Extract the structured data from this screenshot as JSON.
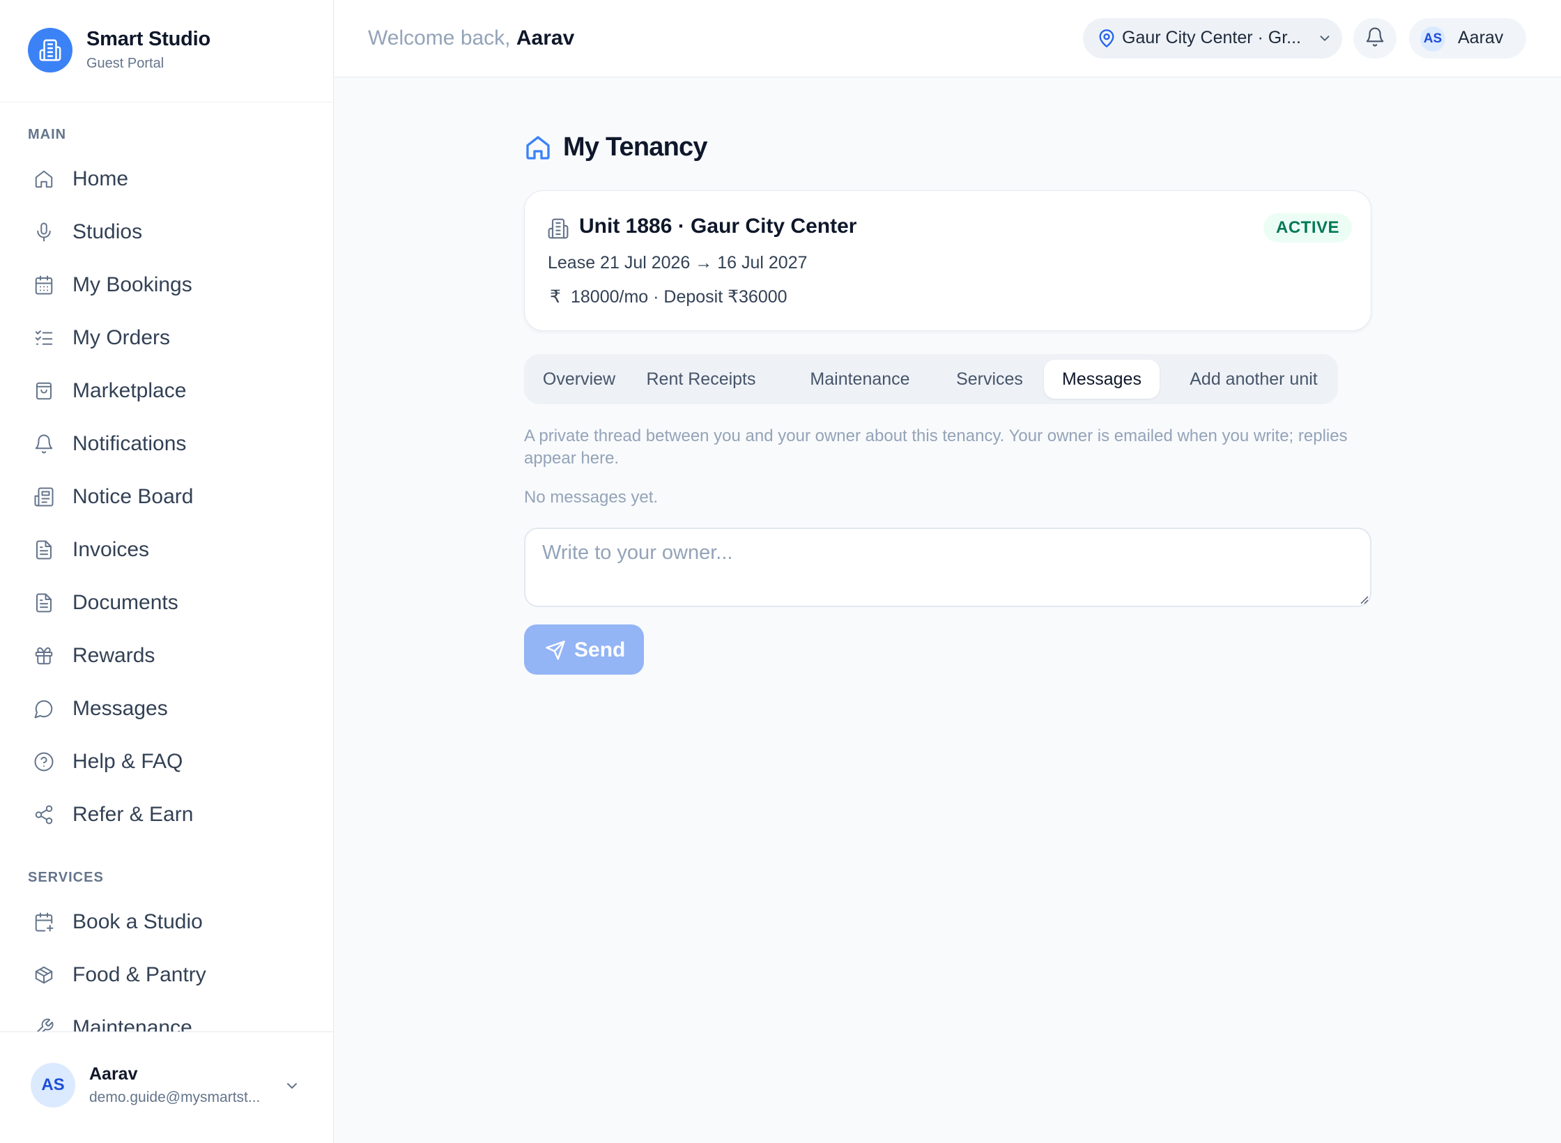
{
  "brand": {
    "title": "Smart Studio",
    "subtitle": "Guest Portal"
  },
  "sidebar": {
    "main_label": "MAIN",
    "main_items": [
      {
        "label": "Home",
        "icon": "home-icon"
      },
      {
        "label": "Studios",
        "icon": "mic-icon"
      },
      {
        "label": "My Bookings",
        "icon": "calendar-icon"
      },
      {
        "label": "My Orders",
        "icon": "list-check-icon"
      },
      {
        "label": "Marketplace",
        "icon": "shopping-bag-icon"
      },
      {
        "label": "Notifications",
        "icon": "bell-icon"
      },
      {
        "label": "Notice Board",
        "icon": "newspaper-icon"
      },
      {
        "label": "Invoices",
        "icon": "file-text-icon"
      },
      {
        "label": "Documents",
        "icon": "document-icon"
      },
      {
        "label": "Rewards",
        "icon": "gift-icon"
      },
      {
        "label": "Messages",
        "icon": "chat-icon"
      },
      {
        "label": "Help & FAQ",
        "icon": "help-circle-icon"
      },
      {
        "label": "Refer & Earn",
        "icon": "share-icon"
      }
    ],
    "services_label": "SERVICES",
    "services_items": [
      {
        "label": "Book a Studio",
        "icon": "calendar-plus-icon"
      },
      {
        "label": "Food & Pantry",
        "icon": "package-icon"
      },
      {
        "label": "Maintenance",
        "icon": "wrench-icon"
      }
    ]
  },
  "user": {
    "initials": "AS",
    "name": "Aarav",
    "email": "demo.guide@mysmartst..."
  },
  "topbar": {
    "welcome_prefix": "Welcome back,",
    "welcome_name": "Aarav",
    "location": "Gaur City Center · Gr...",
    "account_initials": "AS",
    "account_name": "Aarav"
  },
  "page": {
    "title": "My Tenancy"
  },
  "unit": {
    "title": "Unit 1886 · Gaur City Center",
    "status": "ACTIVE",
    "lease": "Lease 21 Jul 2026 → 16 Jul 2027",
    "currency_symbol": "₹",
    "rent": "18000/mo · Deposit ₹36000"
  },
  "tabs": [
    {
      "label": "Overview",
      "active": false
    },
    {
      "label": "Rent Receipts",
      "active": false
    },
    {
      "label": "Maintenance",
      "active": false
    },
    {
      "label": "Services",
      "active": false
    },
    {
      "label": "Messages",
      "active": true
    },
    {
      "label": "Add another unit",
      "active": false
    }
  ],
  "messages": {
    "help": "A private thread between you and your owner about this tenancy. Your owner is emailed when you write; replies appear here.",
    "empty": "No messages yet.",
    "placeholder": "Write to your owner...",
    "send_label": "Send"
  },
  "colors": {
    "accent": "#3b82f6",
    "send_disabled": "#93b4f5",
    "active_badge_bg": "#ecfdf5",
    "active_badge_text": "#047857"
  }
}
